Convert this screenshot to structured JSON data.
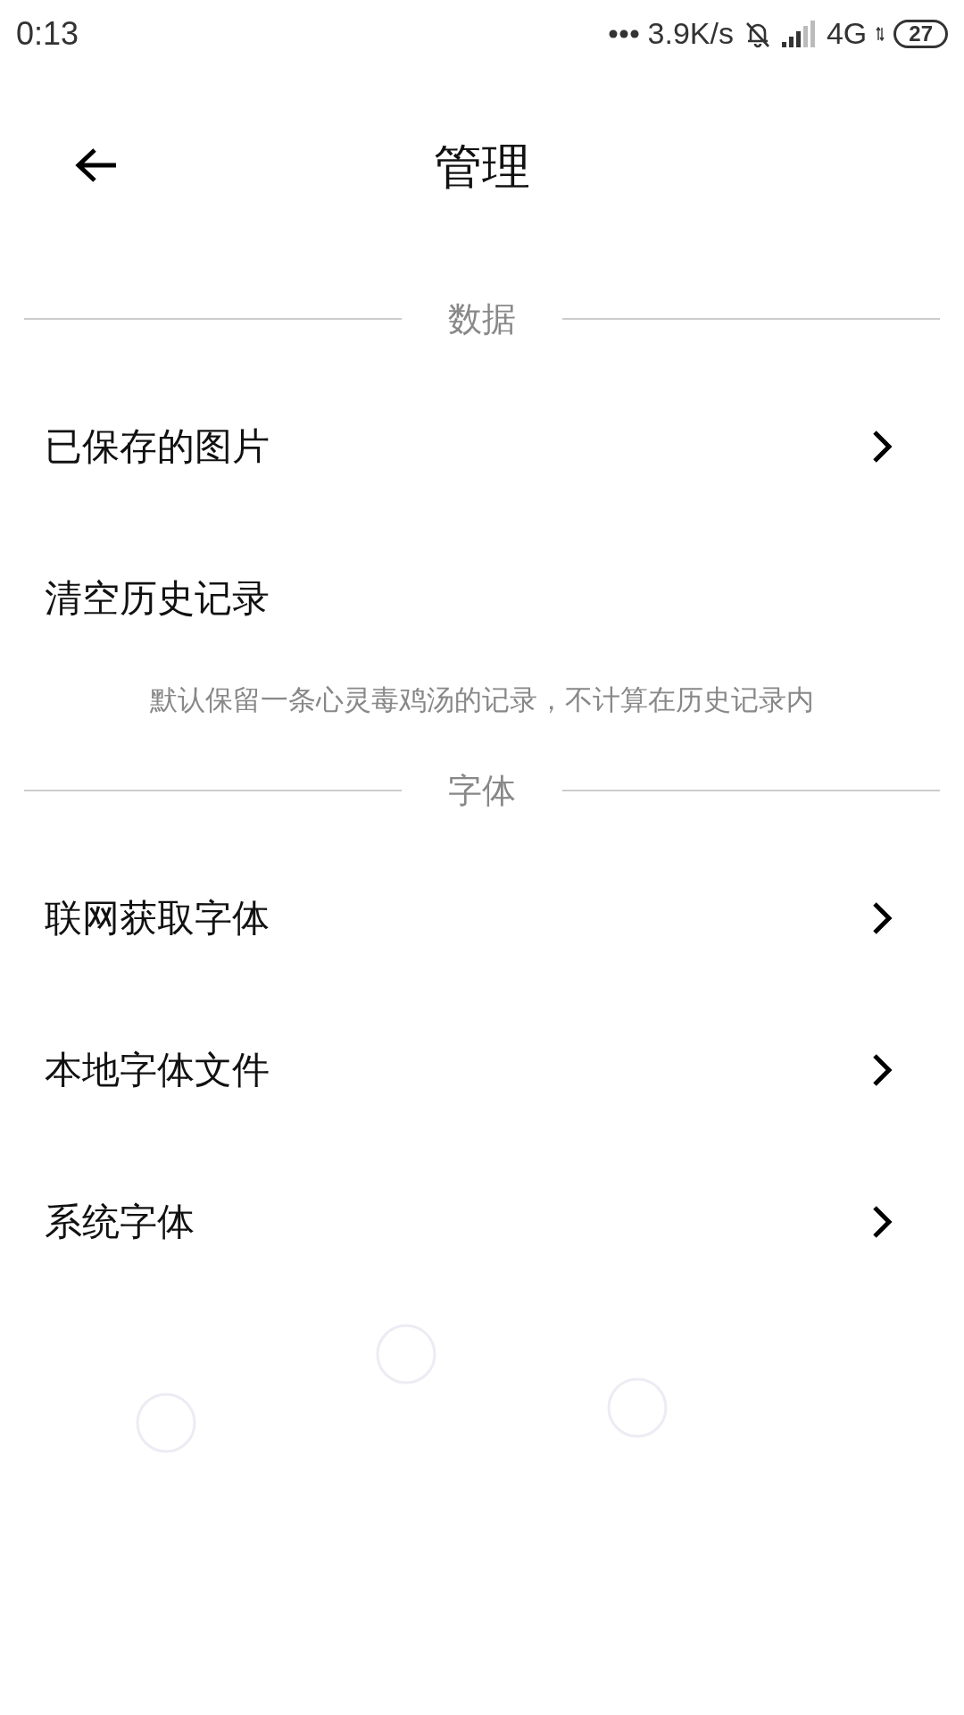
{
  "status_bar": {
    "time": "0:13",
    "speed": "3.9K/s",
    "network": "4G",
    "battery": "27"
  },
  "header": {
    "title": "管理"
  },
  "sections": [
    {
      "title": "数据",
      "items": [
        {
          "label": "已保存的图片",
          "kind": "link"
        },
        {
          "label": "清空历史记录",
          "kind": "action"
        }
      ],
      "note": "默认保留一条心灵毒鸡汤的记录，不计算在历史记录内"
    },
    {
      "title": "字体",
      "items": [
        {
          "label": "联网获取字体",
          "kind": "link"
        },
        {
          "label": "本地字体文件",
          "kind": "link"
        },
        {
          "label": "系统字体",
          "kind": "link"
        }
      ]
    }
  ]
}
